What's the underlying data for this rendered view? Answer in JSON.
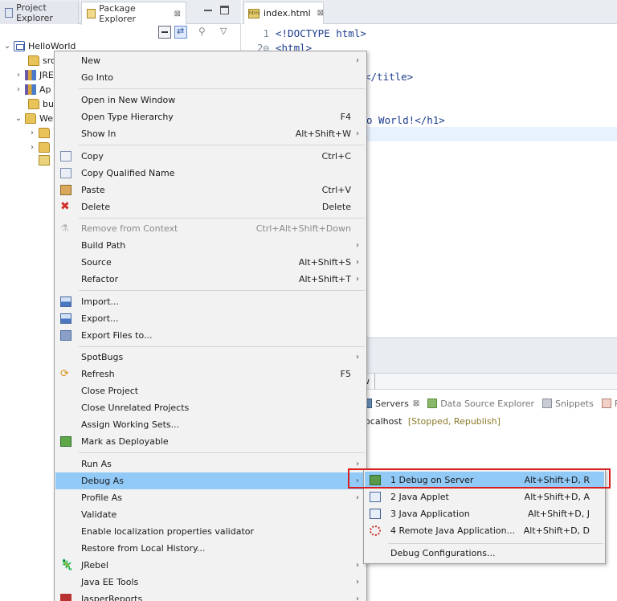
{
  "left_view": {
    "tabs": [
      {
        "label": "Project Explorer"
      },
      {
        "label": "Package Explorer"
      }
    ],
    "close_glyph": "⊠",
    "icons": {
      "minimize": "minimize-icon",
      "maximize": "maximize-icon",
      "collapse_all": "collapse-all-icon",
      "link_with_editor": "link-with-editor-icon",
      "focus": "focus-on-task-icon",
      "view_menu": "view-menu-icon"
    },
    "view_menu_glyph": "▽",
    "focus_glyph": "⚲",
    "tree": [
      {
        "label": "HelloWorld",
        "twisty": "⌄",
        "icon": "project-icon"
      },
      {
        "label": "src",
        "twisty": "",
        "icon": "package-folder-icon"
      },
      {
        "label": "JRE",
        "twisty": "›",
        "icon": "library-icon"
      },
      {
        "label": "Ap",
        "twisty": "›",
        "icon": "library-icon"
      },
      {
        "label": "bu",
        "twisty": "",
        "icon": "folder-icon"
      },
      {
        "label": "We",
        "twisty": "⌄",
        "icon": "folder-icon"
      },
      {
        "label": "",
        "twisty": "›",
        "icon": "folder-icon"
      },
      {
        "label": "",
        "twisty": "›",
        "icon": "folder-icon"
      },
      {
        "label": "",
        "twisty": "",
        "icon": "html-file-icon"
      }
    ]
  },
  "editor": {
    "tab_label": "index.html",
    "tab_icon_text": "html",
    "lines": [
      {
        "num": "1",
        "code": "<!DOCTYPE html>"
      },
      {
        "num": "2⊖",
        "code": "<html>"
      },
      {
        "num": "",
        "code": "</title>"
      },
      {
        "num": "",
        "code": "o World!</h1>"
      }
    ]
  },
  "bottom_panel": {
    "partial_tab": "w",
    "tabs": [
      {
        "label": "Servers",
        "dim": false
      },
      {
        "label": "Data Source Explorer",
        "dim": true
      },
      {
        "label": "Snippets",
        "dim": true
      },
      {
        "label": "Pr",
        "dim": true
      }
    ],
    "server": {
      "name": "localhost",
      "status": "[Stopped, Republish]"
    }
  },
  "context_menu": {
    "submenu_arrow": "›",
    "items": [
      {
        "label": "New",
        "shortcut": "",
        "submenu": true,
        "icon": ""
      },
      {
        "label": "Go Into",
        "shortcut": "",
        "submenu": false,
        "icon": ""
      },
      {
        "label": "Open in New Window",
        "shortcut": "",
        "submenu": false,
        "icon": ""
      },
      {
        "label": "Open Type Hierarchy",
        "shortcut": "F4",
        "submenu": false,
        "icon": ""
      },
      {
        "label": "Show In",
        "shortcut": "Alt+Shift+W",
        "submenu": true,
        "icon": ""
      },
      {
        "label": "Copy",
        "shortcut": "Ctrl+C",
        "submenu": false,
        "icon": "copy-icon"
      },
      {
        "label": "Copy Qualified Name",
        "shortcut": "",
        "submenu": false,
        "icon": "copy-qualified-name-icon"
      },
      {
        "label": "Paste",
        "shortcut": "Ctrl+V",
        "submenu": false,
        "icon": "paste-icon"
      },
      {
        "label": "Delete",
        "shortcut": "Delete",
        "submenu": false,
        "icon": "delete-icon"
      },
      {
        "label": "Remove from Context",
        "shortcut": "Ctrl+Alt+Shift+Down",
        "submenu": false,
        "icon": "remove-from-context-icon",
        "disabled": true
      },
      {
        "label": "Build Path",
        "shortcut": "",
        "submenu": true,
        "icon": ""
      },
      {
        "label": "Source",
        "shortcut": "Alt+Shift+S",
        "submenu": true,
        "icon": ""
      },
      {
        "label": "Refactor",
        "shortcut": "Alt+Shift+T",
        "submenu": true,
        "icon": ""
      },
      {
        "label": "Import...",
        "shortcut": "",
        "submenu": false,
        "icon": "import-icon"
      },
      {
        "label": "Export...",
        "shortcut": "",
        "submenu": false,
        "icon": "export-icon"
      },
      {
        "label": "Export Files to...",
        "shortcut": "",
        "submenu": false,
        "icon": "export-files-icon"
      },
      {
        "label": "SpotBugs",
        "shortcut": "",
        "submenu": true,
        "icon": ""
      },
      {
        "label": "Refresh",
        "shortcut": "F5",
        "submenu": false,
        "icon": "refresh-icon"
      },
      {
        "label": "Close Project",
        "shortcut": "",
        "submenu": false,
        "icon": ""
      },
      {
        "label": "Close Unrelated Projects",
        "shortcut": "",
        "submenu": false,
        "icon": ""
      },
      {
        "label": "Assign Working Sets...",
        "shortcut": "",
        "submenu": false,
        "icon": ""
      },
      {
        "label": "Mark as Deployable",
        "shortcut": "",
        "submenu": false,
        "icon": "deploy-icon"
      },
      {
        "label": "Run As",
        "shortcut": "",
        "submenu": true,
        "icon": ""
      },
      {
        "label": "Debug As",
        "shortcut": "",
        "submenu": true,
        "icon": "",
        "highlight": true
      },
      {
        "label": "Profile As",
        "shortcut": "",
        "submenu": true,
        "icon": ""
      },
      {
        "label": "Validate",
        "shortcut": "",
        "submenu": false,
        "icon": ""
      },
      {
        "label": "Enable localization properties validator",
        "shortcut": "",
        "submenu": false,
        "icon": ""
      },
      {
        "label": "Restore from Local History...",
        "shortcut": "",
        "submenu": false,
        "icon": ""
      },
      {
        "label": "JRebel",
        "shortcut": "",
        "submenu": true,
        "icon": "jrebel-icon"
      },
      {
        "label": "Java EE Tools",
        "shortcut": "",
        "submenu": true,
        "icon": ""
      },
      {
        "label": "JasperReports",
        "shortcut": "",
        "submenu": true,
        "icon": "jasperreports-icon"
      }
    ]
  },
  "debug_submenu": {
    "items": [
      {
        "label": "1 Debug on Server",
        "shortcut": "Alt+Shift+D, R",
        "icon": "debug-on-server-icon",
        "highlight": true
      },
      {
        "label": "2 Java Applet",
        "shortcut": "Alt+Shift+D, A",
        "icon": "java-applet-icon"
      },
      {
        "label": "3 Java Application",
        "shortcut": "Alt+Shift+D, J",
        "icon": "java-application-icon"
      },
      {
        "label": "4 Remote Java Application...",
        "shortcut": "Alt+Shift+D, D",
        "icon": "remote-java-application-icon"
      },
      {
        "label": "Debug Configurations...",
        "shortcut": "",
        "icon": ""
      }
    ]
  },
  "colors": {
    "highlight": "#91c9f7",
    "annotation_box": "#d81e1e"
  }
}
